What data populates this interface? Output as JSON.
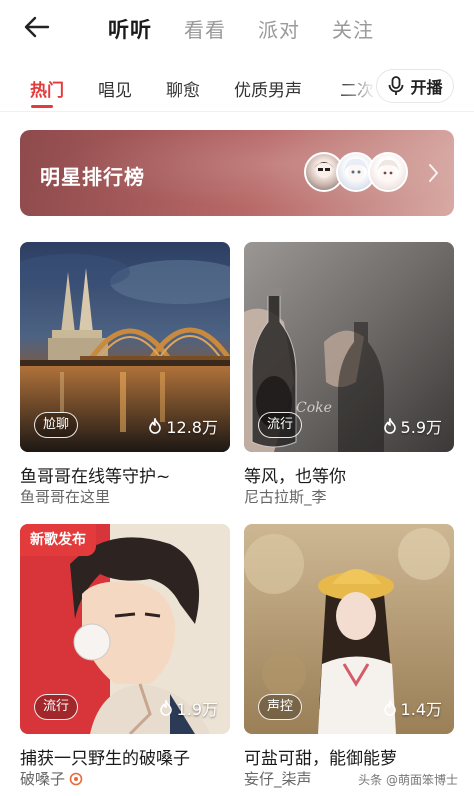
{
  "topnav": {
    "tabs": [
      {
        "label": "听听",
        "active": true
      },
      {
        "label": "看看",
        "active": false
      },
      {
        "label": "派对",
        "active": false
      },
      {
        "label": "关注",
        "active": false
      }
    ]
  },
  "categories": {
    "items": [
      "热门",
      "唱见",
      "聊愈",
      "优质男声",
      "二次"
    ],
    "active_index": 0,
    "live_button": {
      "label": "开播",
      "icon": "microphone-icon"
    }
  },
  "rank_banner": {
    "title": "明星排行榜",
    "icon": "chevron-right-icon"
  },
  "cards": [
    {
      "tag": "尬聊",
      "heat": "12.8万",
      "title": "鱼哥哥在线等守护~",
      "host": "鱼哥哥在这里",
      "badge": ""
    },
    {
      "tag": "流行",
      "heat": "5.9万",
      "title": "等风，也等你",
      "host": "尼古拉斯_李",
      "badge": ""
    },
    {
      "tag": "流行",
      "heat": "1.9万",
      "title": "捕获一只野生的破嗓子",
      "host": "破嗓子",
      "badge": "新歌发布"
    },
    {
      "tag": "声控",
      "heat": "1.4万",
      "title": "可盐可甜，能御能萝",
      "host": "妄仔_柒声",
      "badge": ""
    }
  ],
  "watermark": "头条 @萌面笨博士",
  "colors": {
    "accent": "#e33b3b",
    "banner": "#a65a5a"
  }
}
